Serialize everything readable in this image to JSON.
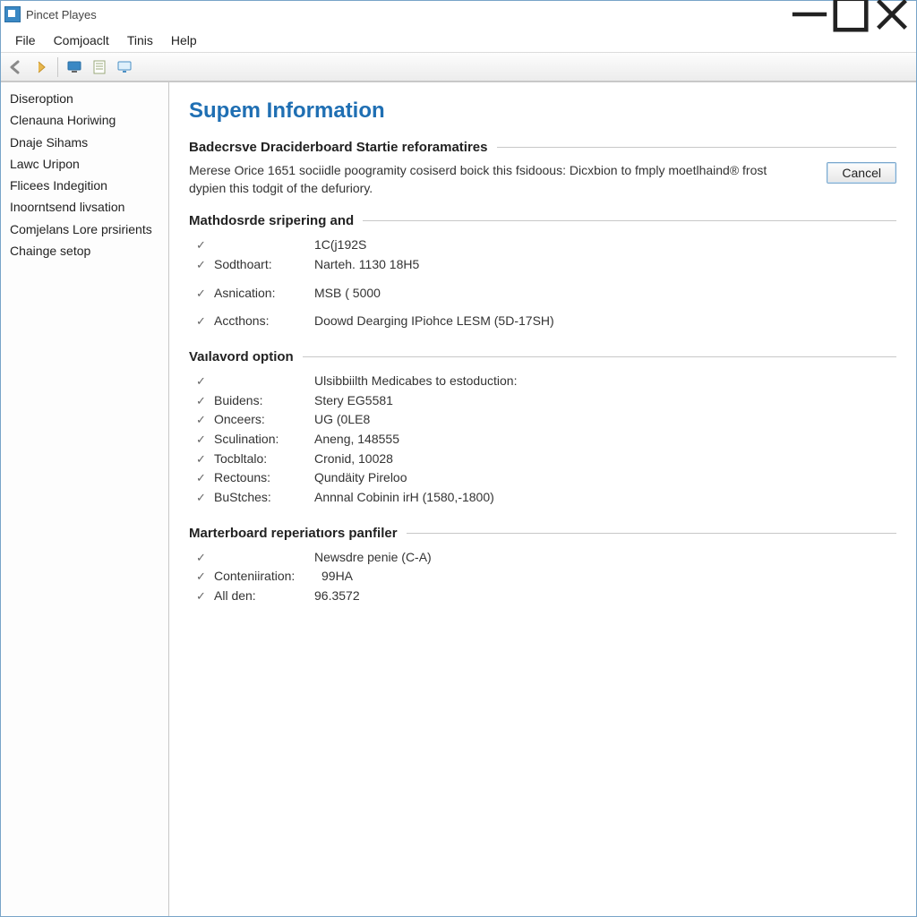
{
  "app": {
    "title": "Pincet Playes"
  },
  "menu": {
    "file": "File",
    "comjoaclt": "Comjoaclt",
    "tinis": "Tinis",
    "help": "Help"
  },
  "sidebar": {
    "items": [
      {
        "label": "Diseroption"
      },
      {
        "label": "Clenauna Horiwing"
      },
      {
        "label": "Dnaje Sihams"
      },
      {
        "label": "Lawc Uripon"
      },
      {
        "label": "Flicees Indegition"
      },
      {
        "label": "Inoorntsend livsation"
      },
      {
        "label": "Comjelans Lore prsirients"
      },
      {
        "label": "Chainge setop"
      }
    ]
  },
  "main": {
    "title": "Supem Information",
    "section1_heading": "Badecrsve Draciderboard Startie reforamatires",
    "intro": "Merese Orice 1651 sociidle poogramity cosiserd boick this fsidoous: Dicxbion to fmply moetlhaind® frost dypien this todgit of the defuriory.",
    "cancel_label": "Cancel",
    "section2_heading": "Mathdosrde sripering and",
    "section2": [
      {
        "label": "",
        "value": "1C(j192S"
      },
      {
        "label": "Sodthoart:",
        "value": "Narteh. 1130 18H5"
      },
      {
        "label": "Asnication:",
        "value": "MSB ( 5000"
      },
      {
        "label": "Accthons:",
        "value": "Doowd Dearging IPiohce LESM (5D-17SH)"
      }
    ],
    "section3_heading": "Vaılavord option",
    "section3": [
      {
        "label": "",
        "value": "Ulsibbiilth Medicabes to estoduction:"
      },
      {
        "label": "Buidens:",
        "value": "Stery EG5581"
      },
      {
        "label": "Onceers:",
        "value": "UG (0LE8"
      },
      {
        "label": "Sculination:",
        "value": "Aneng, 148555"
      },
      {
        "label": "Tocbltalo:",
        "value": "Cronid, 10028"
      },
      {
        "label": "Rectouns:",
        "value": "Qundäity Pireloo"
      },
      {
        "label": "BuStches:",
        "value": "Annnal Cobinin irH (1580,-1800)"
      }
    ],
    "section4_heading": "Marterboard reperiatıors panfiler",
    "section4": [
      {
        "label": "",
        "value": "Newsdre penie (C-A)"
      },
      {
        "label": "Conteniiration:",
        "value": "99HA"
      },
      {
        "label": "All den:",
        "value": "96.3572"
      }
    ]
  }
}
